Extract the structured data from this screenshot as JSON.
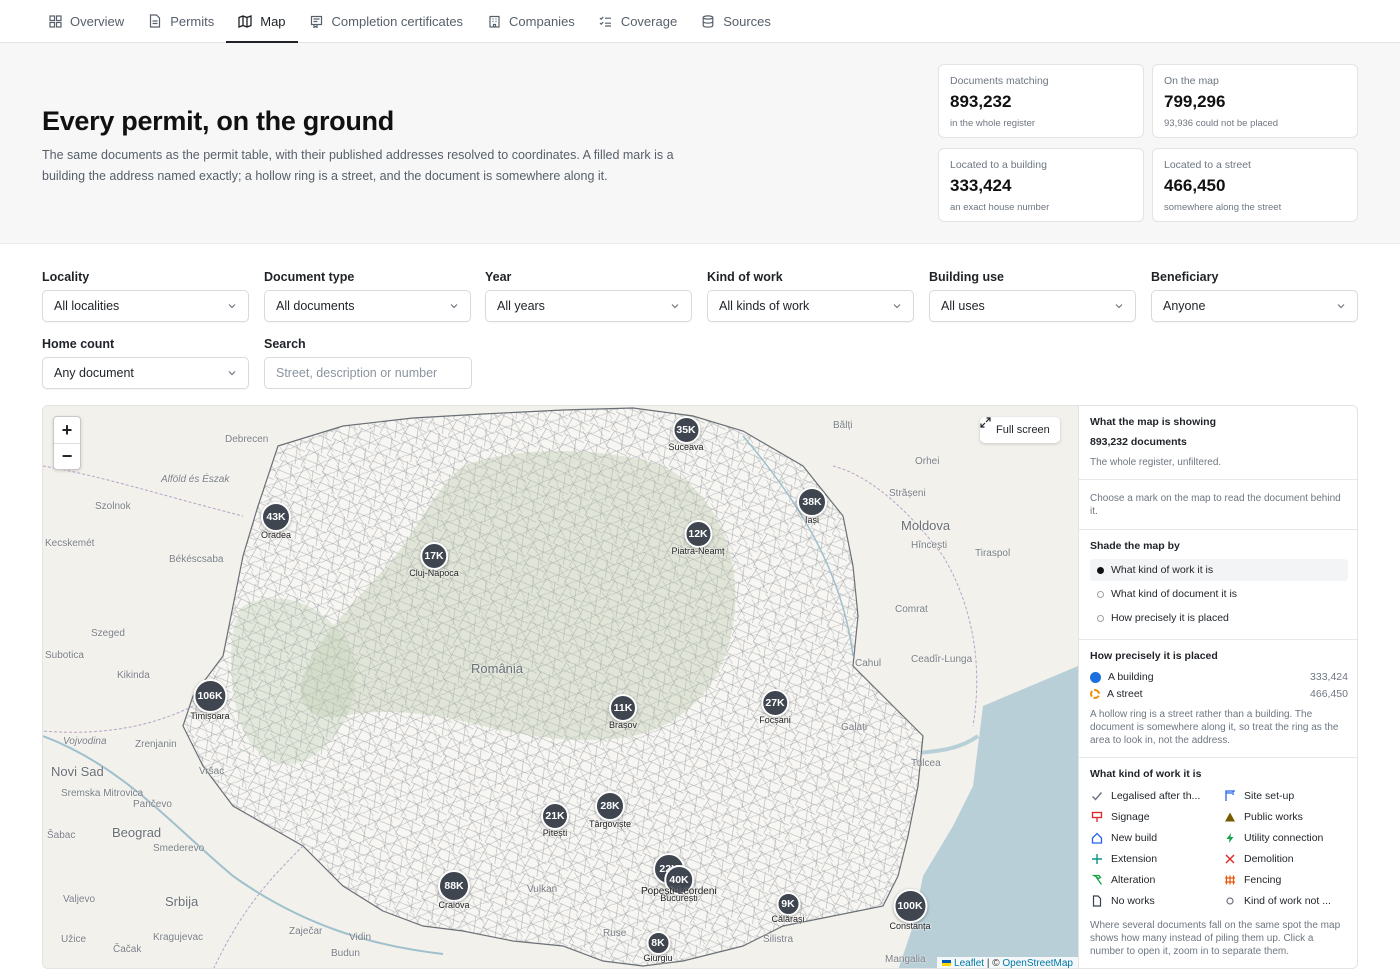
{
  "nav": {
    "items": [
      {
        "label": "Overview",
        "icon": "grid-icon"
      },
      {
        "label": "Permits",
        "icon": "document-icon"
      },
      {
        "label": "Map",
        "icon": "map-icon",
        "active": true
      },
      {
        "label": "Completion certificates",
        "icon": "certificate-icon"
      },
      {
        "label": "Companies",
        "icon": "building-icon"
      },
      {
        "label": "Coverage",
        "icon": "checklist-icon"
      },
      {
        "label": "Sources",
        "icon": "database-icon"
      }
    ]
  },
  "hero": {
    "title": "Every permit, on the ground",
    "description": "The same documents as the permit table, with their published addresses resolved to coordinates. A filled mark is a building the address named exactly; a hollow ring is a street, and the document is somewhere along it."
  },
  "stats": {
    "matching": {
      "label": "Documents matching",
      "value": "893,232",
      "sub": "in the whole register"
    },
    "on_map": {
      "label": "On the map",
      "value": "799,296",
      "sub": "93,936 could not be placed"
    },
    "building": {
      "label": "Located to a building",
      "value": "333,424",
      "sub": "an exact house number"
    },
    "street": {
      "label": "Located to a street",
      "value": "466,450",
      "sub": "somewhere along the street"
    }
  },
  "filters": {
    "locality": {
      "label": "Locality",
      "value": "All localities"
    },
    "doctype": {
      "label": "Document type",
      "value": "All documents"
    },
    "year": {
      "label": "Year",
      "value": "All years"
    },
    "kind": {
      "label": "Kind of work",
      "value": "All kinds of work"
    },
    "use": {
      "label": "Building use",
      "value": "All uses"
    },
    "beneficiary": {
      "label": "Beneficiary",
      "value": "Anyone"
    },
    "homecount": {
      "label": "Home count",
      "value": "Any document"
    },
    "search": {
      "label": "Search",
      "placeholder": "Street, description or number"
    }
  },
  "map": {
    "zoom_in": "+",
    "zoom_out": "−",
    "fullscreen": "Full screen",
    "attribution_leaflet": "Leaflet",
    "attribution_sep": " | © ",
    "attribution_osm": "OpenStreetMap",
    "clusters": [
      {
        "count": "35K",
        "city": "Suceava"
      },
      {
        "count": "38K",
        "city": "Iași"
      },
      {
        "count": "43K",
        "city": "Oradea"
      },
      {
        "count": "12K",
        "city": "Piatra-Neamț"
      },
      {
        "count": "17K",
        "city": "Cluj-Napoca"
      },
      {
        "count": "106K",
        "city": "Timișoara"
      },
      {
        "count": "11K",
        "city": "Brașov"
      },
      {
        "count": "27K",
        "city": "Focșani"
      },
      {
        "count": "28K",
        "city": "Târgoviște"
      },
      {
        "count": "21K",
        "city": "Pitești"
      },
      {
        "count": "22K",
        "city": ""
      },
      {
        "count": "40K",
        "city": "București"
      },
      {
        "count": "",
        "city": "Popești-Leordeni"
      },
      {
        "count": "88K",
        "city": "Craiova"
      },
      {
        "count": "9K",
        "city": "Călărași"
      },
      {
        "count": "100K",
        "city": "Constanța"
      },
      {
        "count": "8K",
        "city": "Giurgiu"
      }
    ],
    "place_labels": [
      "Debrecen",
      "Szolnok",
      "Alföld és Észak",
      "Kecskemét",
      "Békéscsaba",
      "Szeged",
      "Subotica",
      "Kikinda",
      "Vojvodina",
      "Zrenjanin",
      "Novi Sad",
      "Vršac",
      "Sremska Mitrovica",
      "Pančevo",
      "Beograd",
      "Šabac",
      "Smederevo",
      "Srbija",
      "Valjevo",
      "Kragujevac",
      "Užice",
      "Čačak",
      "Zaječar",
      "Vidin",
      "Moldova",
      "Orhei",
      "Bălți",
      "Strășeni",
      "Hîncești",
      "Tiraspol",
      "Comrat",
      "Ceadîr-Lunga",
      "Cahul",
      "Galați",
      "Tulcea",
      "România",
      "Mangalia",
      "Silistra",
      "Vulkan",
      "Ruse",
      "Budun"
    ]
  },
  "panel": {
    "showing": {
      "title": "What the map is showing",
      "count": "893,232 documents",
      "note": "The whole register, unfiltered."
    },
    "hint": "Choose a mark on the map to read the document behind it.",
    "shade": {
      "title": "Shade the map by",
      "options": [
        "What kind of work it is",
        "What kind of document it is",
        "How precisely it is placed"
      ],
      "selected": 0
    },
    "precision": {
      "title": "How precisely it is placed",
      "building_label": "A building",
      "building_value": "333,424",
      "street_label": "A street",
      "street_value": "466,450",
      "note": "A hollow ring is a street rather than a building. The document is somewhere along it, so treat the ring as the area to look in, not the address."
    },
    "work": {
      "title": "What kind of work it is",
      "items": [
        {
          "label": "Legalised after th...",
          "icon": "check-icon",
          "color": "#6b7280"
        },
        {
          "label": "Site set-up",
          "icon": "crane-icon",
          "color": "#2563eb"
        },
        {
          "label": "Signage",
          "icon": "sign-icon",
          "color": "#dc2626"
        },
        {
          "label": "Public works",
          "icon": "triangle-icon",
          "color": "#7a5c00"
        },
        {
          "label": "New build",
          "icon": "house-icon",
          "color": "#2563eb"
        },
        {
          "label": "Utility connection",
          "icon": "bolt-icon",
          "color": "#16a34a"
        },
        {
          "label": "Extension",
          "icon": "plus-icon",
          "color": "#0d9488"
        },
        {
          "label": "Demolition",
          "icon": "x-icon",
          "color": "#dc2626"
        },
        {
          "label": "Alteration",
          "icon": "hammer-icon",
          "color": "#16a34a"
        },
        {
          "label": "Fencing",
          "icon": "fence-icon",
          "color": "#ea580c"
        },
        {
          "label": "No works",
          "icon": "page-icon",
          "color": "#374151"
        },
        {
          "label": "Kind of work not ...",
          "icon": "circle-icon",
          "color": "#6b7280"
        }
      ],
      "note": "Where several documents fall on the same spot the map shows how many instead of piling them up. Click a number to open it, zoom in to separate them."
    },
    "colors": {
      "building": "#1d6fe0",
      "street": "#f08c00",
      "cluster": "#3f4650"
    }
  }
}
